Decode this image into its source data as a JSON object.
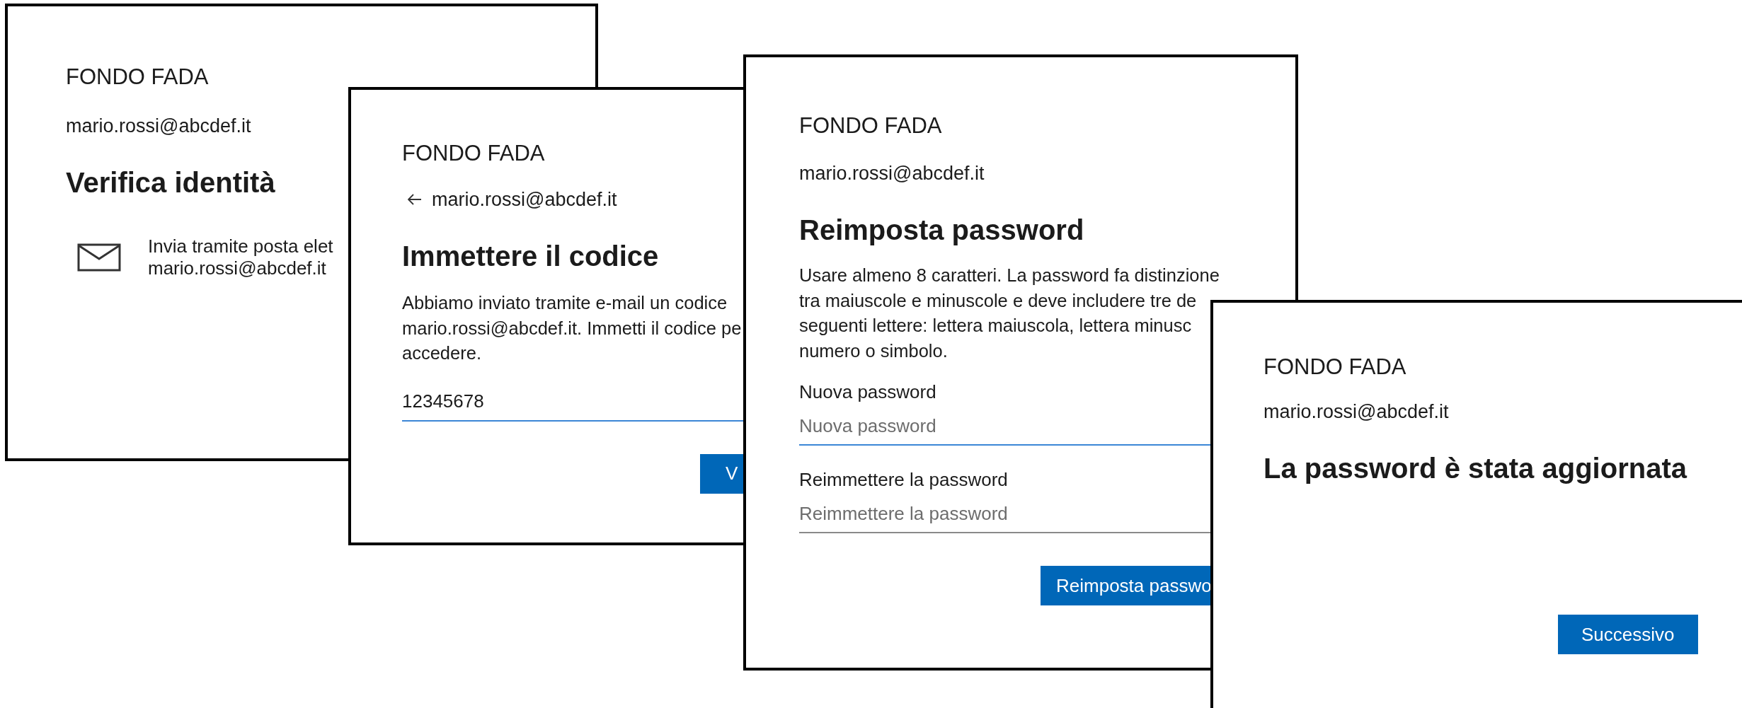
{
  "screens": [
    {
      "kind": "verify",
      "brand": "FONDO FADA",
      "account": "mario.rossi@abcdef.it",
      "heading": "Verifica identità",
      "options": [
        {
          "kind": "email",
          "lines": [
            "Invia tramite posta elet",
            "mario.rossi@abcdef.it"
          ]
        }
      ]
    },
    {
      "kind": "code",
      "brand": "FONDO FADA",
      "back_account": "mario.rossi@abcdef.it",
      "heading": "Immettere il codice",
      "message_lines": [
        "Abbiamo inviato tramite e-mail un codice",
        "mario.rossi@abcdef.it. Immetti il codice pe",
        "accedere."
      ],
      "fields": [
        {
          "value": "12345678",
          "focused": true
        }
      ],
      "button": "V"
    },
    {
      "kind": "reset",
      "brand": "FONDO FADA",
      "account": "mario.rossi@abcdef.it",
      "heading": "Reimposta password",
      "message_lines": [
        "Usare almeno 8 caratteri. La password fa distinzione",
        "tra maiuscole e minuscole e deve includere tre de",
        "seguenti lettere: lettera maiuscola, lettera minusc",
        "numero o simbolo."
      ],
      "fields": [
        {
          "label": "Nuova password",
          "placeholder": "Nuova password",
          "focused": true
        },
        {
          "label": "Reimmettere la password",
          "placeholder": "Reimmettere la password",
          "focused": false
        }
      ],
      "button": "Reimposta passwo"
    },
    {
      "kind": "done",
      "brand": "FONDO FADA",
      "account": "mario.rossi@abcdef.it",
      "heading": "La password è stata aggiornata",
      "button": "Successivo"
    }
  ]
}
